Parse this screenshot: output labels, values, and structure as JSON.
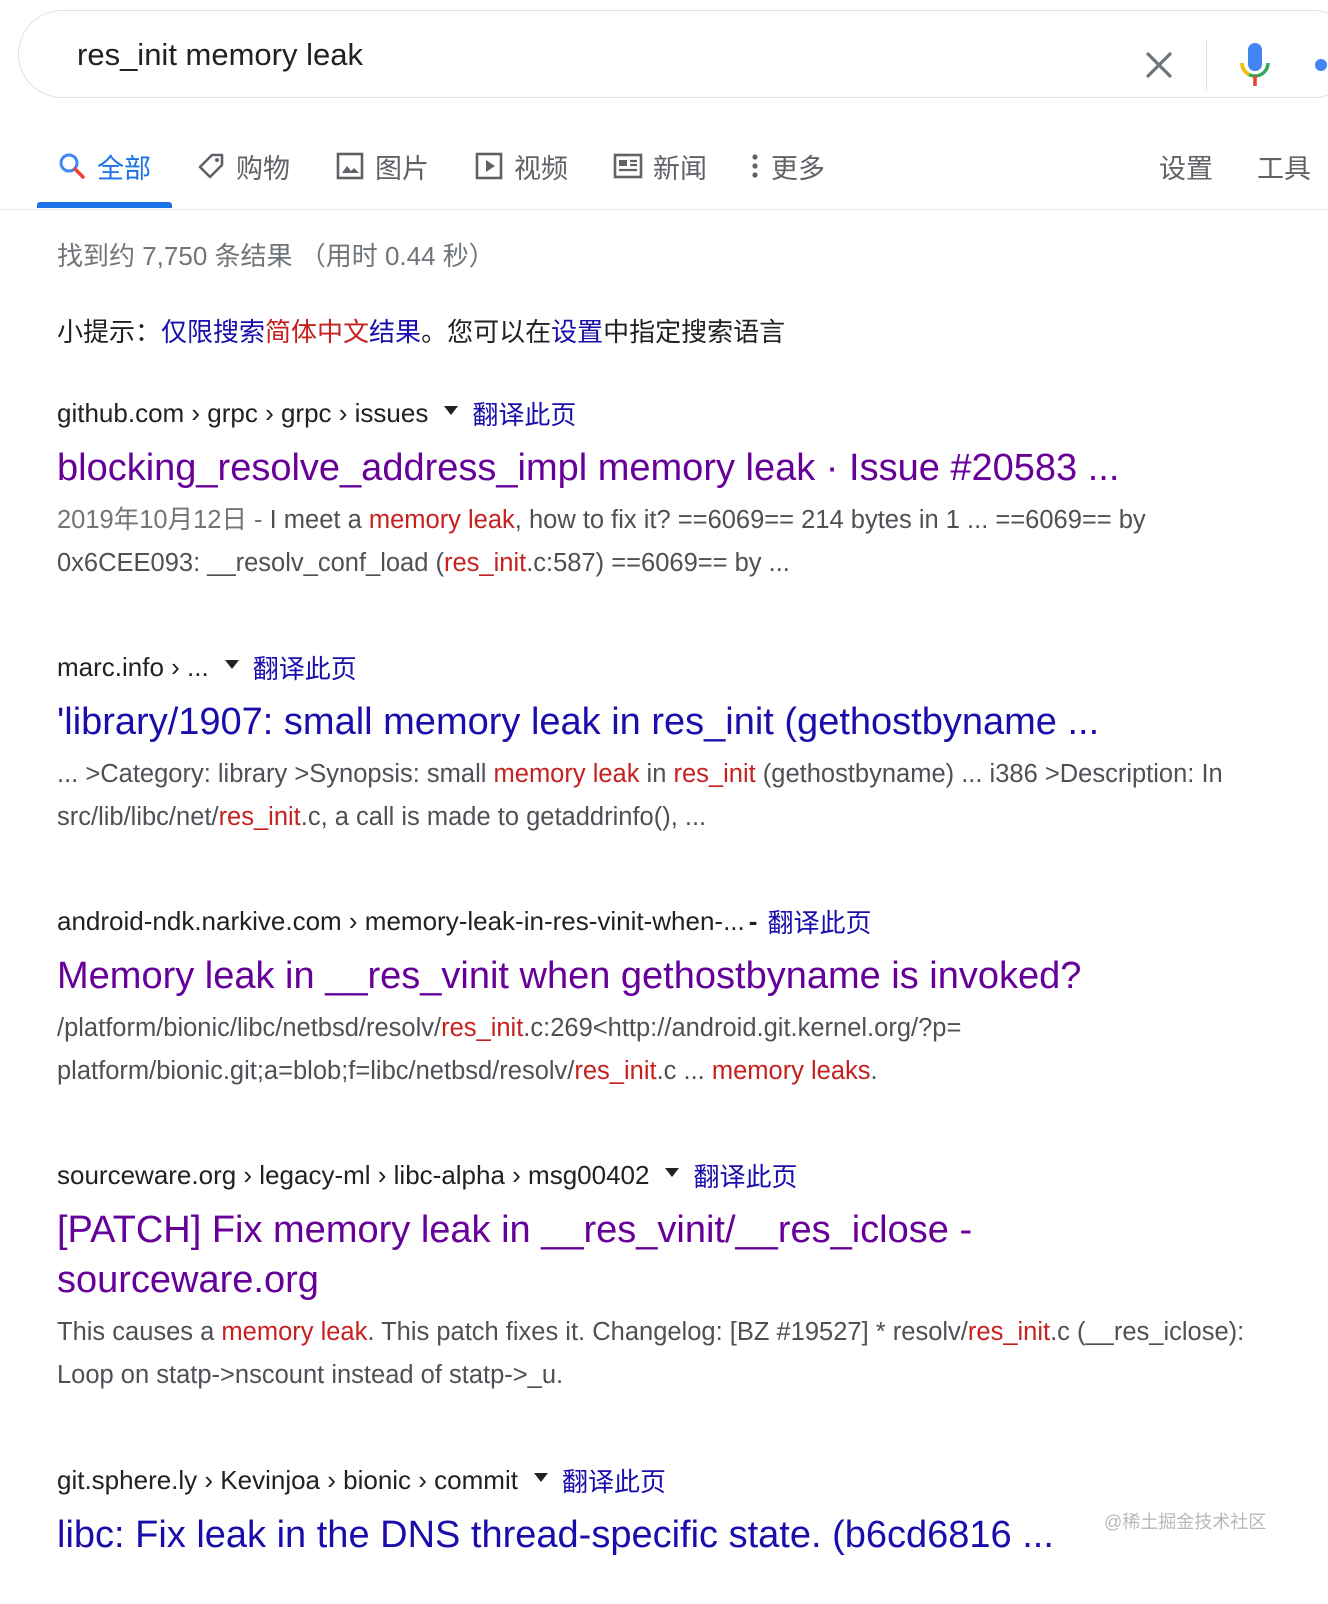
{
  "search": {
    "query": "res_init memory leak"
  },
  "tabs": [
    {
      "label": "全部",
      "icon": "search-icon"
    },
    {
      "label": "购物",
      "icon": "tag-icon"
    },
    {
      "label": "图片",
      "icon": "image-icon"
    },
    {
      "label": "视频",
      "icon": "video-icon"
    },
    {
      "label": "新闻",
      "icon": "news-icon"
    },
    {
      "label": "更多",
      "icon": "more-vert-icon"
    }
  ],
  "tools": {
    "settings": "设置",
    "tools": "工具"
  },
  "stats": "找到约 7,750 条结果 （用时 0.44 秒）",
  "tip": {
    "prefix": "小提示：",
    "link1": "仅限搜索",
    "lang": "简体中文",
    "link2": "结果",
    "mid": "。您可以在",
    "settings": "设置",
    "suffix": "中指定搜索语言"
  },
  "translate_label": "翻译此页",
  "results": [
    {
      "cite": "github.com › grpc › grpc › issues",
      "title": "blocking_resolve_address_impl memory leak · Issue #20583 ...",
      "snippet": [
        {
          "t": "2019年10月12日 - ",
          "s": "date"
        },
        {
          "t": "I meet a "
        },
        {
          "t": "memory leak",
          "s": "hl"
        },
        {
          "t": ", how to fix it? ==6069== 214 bytes in 1 ... ==6069== by 0x6CEE093: __resolv_conf_load ("
        },
        {
          "t": "res_init",
          "s": "hl"
        },
        {
          "t": ".c:587) ==6069== by ..."
        }
      ]
    },
    {
      "cite": "marc.info › ...",
      "title": "'library/1907: small memory leak in res_init (gethostbyname ...",
      "snippet": [
        {
          "t": "... >Category: library >Synopsis: small "
        },
        {
          "t": "memory leak",
          "s": "hl"
        },
        {
          "t": " in "
        },
        {
          "t": "res_init",
          "s": "hl"
        },
        {
          "t": " (gethostbyname) ... i386 >Description: In src/lib/libc/net/"
        },
        {
          "t": "res_init",
          "s": "hl"
        },
        {
          "t": ".c, a call is made to getaddrinfo(), ..."
        }
      ]
    },
    {
      "cite": "android-ndk.narkive.com › memory-leak-in-res-vinit-when-...",
      "title": "Memory leak in __res_vinit when gethostbyname is invoked?",
      "snippet": [
        {
          "t": "/platform/bionic/libc/netbsd/resolv/"
        },
        {
          "t": "res_init",
          "s": "hl"
        },
        {
          "t": ".c:269<http://android.git.kernel.org/?p= platform/bionic.git;a=blob;f=libc/netbsd/resolv/"
        },
        {
          "t": "res_init",
          "s": "hl"
        },
        {
          "t": ".c ... "
        },
        {
          "t": "memory leaks",
          "s": "hl"
        },
        {
          "t": "."
        }
      ]
    },
    {
      "cite": "sourceware.org › legacy-ml › libc-alpha › msg00402",
      "title": "[PATCH] Fix memory leak in __res_vinit/__res_iclose - sourceware.org",
      "snippet": [
        {
          "t": "This causes a "
        },
        {
          "t": "memory leak",
          "s": "hl"
        },
        {
          "t": ". This patch fixes it. Changelog: [BZ #19527] * resolv/"
        },
        {
          "t": "res_init",
          "s": "hl"
        },
        {
          "t": ".c (__res_iclose): Loop on statp->nscount instead of statp->_u."
        }
      ]
    },
    {
      "cite": "git.sphere.ly › Kevinjoa › bionic › commit",
      "title": "libc: Fix leak in the DNS thread-specific state. (b6cd6816 ...",
      "snippet": []
    }
  ],
  "watermark": "@稀土掘金技术社区"
}
